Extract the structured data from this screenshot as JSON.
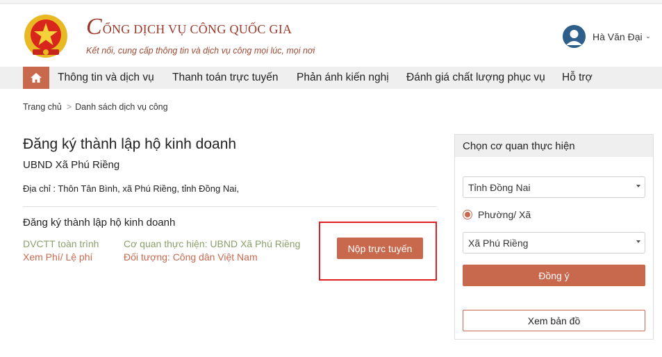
{
  "header": {
    "title_initial": "C",
    "title_rest": "ỔNG DỊCH VỤ CÔNG QUỐC GIA",
    "subtitle": "Kết nối, cung cấp thông tin và dịch vụ công mọi lúc, mọi nơi",
    "user_name": "Hà Văn Đại",
    "emblem_icon": "national-emblem-icon",
    "avatar_icon": "user-avatar-icon"
  },
  "nav": {
    "home_icon": "home-icon",
    "items": [
      {
        "label": "Thông tin và dịch vụ"
      },
      {
        "label": "Thanh toán trực tuyến"
      },
      {
        "label": "Phản ánh kiến nghị"
      },
      {
        "label": "Đánh giá chất lượng phục vụ"
      },
      {
        "label": "Hỗ trợ"
      }
    ]
  },
  "breadcrumb": {
    "home": "Trang chủ",
    "separator": ">",
    "current": "Danh sách dịch vụ công"
  },
  "service": {
    "title": "Đăng ký thành lập hộ kinh doanh",
    "org": "UBND Xã Phú Riềng",
    "address": "Địa chỉ : Thôn Tân Bình, xã Phú Riềng, tỉnh Đồng Nai,",
    "procedure_name": "Đăng ký thành lập hộ kinh doanh",
    "level": "DVCTT toàn trình",
    "fee_link": "Xem Phí/ Lệ phí",
    "agency": "Cơ quan thực hiện: UBND Xã Phú Riềng",
    "subject": "Đối tượng: Công dân Việt Nam",
    "submit_label": "Nộp trực tuyến"
  },
  "panel": {
    "heading": "Chọn cơ quan thực hiện",
    "province_value": "Tỉnh Đồng Nai",
    "radio_label": "Phường/ Xã",
    "ward_value": "Xã Phú Riềng",
    "agree_label": "Đồng ý",
    "map_label": "Xem bản đồ"
  },
  "colors": {
    "accent": "#c8694e",
    "brand_title": "#9b3a2a",
    "meta_green": "#8aa06a",
    "highlight_red": "#e02020"
  }
}
